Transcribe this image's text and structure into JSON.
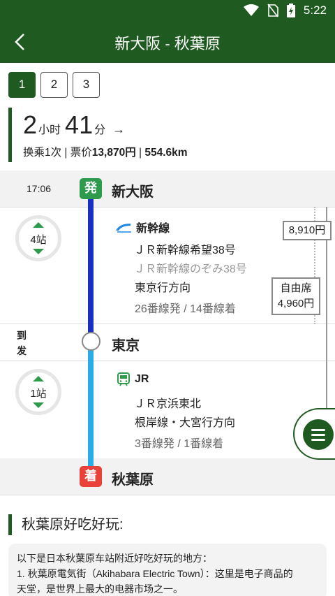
{
  "status_bar": {
    "time": "5:22",
    "icons": [
      "wifi-icon",
      "no-sim-icon",
      "battery-charging-icon"
    ]
  },
  "header": {
    "title": "新大阪 - 秋葉原",
    "back_icon": "chevron-left-icon"
  },
  "tabs": [
    {
      "label": "1",
      "active": true
    },
    {
      "label": "2",
      "active": false
    },
    {
      "label": "3",
      "active": false
    }
  ],
  "summary": {
    "hours": "2",
    "hours_unit": "小时",
    "minutes": "41",
    "minutes_unit": "分",
    "arrow": "→",
    "transfer": "换乘1次",
    "sep": " | ",
    "fare_label": "票价",
    "fare": "13,870円",
    "distance": "554.6km"
  },
  "route": {
    "start": {
      "time": "17:06",
      "badge": "発",
      "name": "新大阪",
      "badge_color": "#2e9b4c"
    },
    "segment1": {
      "stops": "4站",
      "type": "新幹線",
      "line1": "ＪＲ新幹線希望38号",
      "line2": "ＪＲ新幹線のぞみ38号",
      "direction": "東京行方向",
      "platforms": "26番線発 / 14番線着",
      "price": "8,910円",
      "seat_label": "自由席",
      "seat_price": "4,960円",
      "color": "#1a2fbf"
    },
    "transfer": {
      "arrive": "到",
      "depart": "发",
      "name": "東京"
    },
    "segment2": {
      "stops": "1站",
      "type": "JR",
      "line1": "ＪＲ京浜東北",
      "direction": "根岸線・大宮行方向",
      "platforms": "3番線発 / 1番線着",
      "color": "#2aaae8"
    },
    "end": {
      "badge": "着",
      "name": "秋葉原",
      "badge_color": "#e8423a"
    }
  },
  "fab": {
    "icon": "menu-icon"
  },
  "info": {
    "title": "秋葉原好吃好玩:",
    "line1": "以下是日本秋葉原车站附近好吃好玩的地方：",
    "line2": "1. 秋葉原電気街（Akihabara Electric Town）：这里是电子商品的",
    "line3": "天堂，是世界上最大的电器市场之一。"
  },
  "colors": {
    "primary": "#1f5a20",
    "accent_green": "#2e9b4c",
    "shinkansen_blue": "#1a2fbf",
    "jr_blue": "#2aaae8",
    "arrival_red": "#e8423a"
  }
}
